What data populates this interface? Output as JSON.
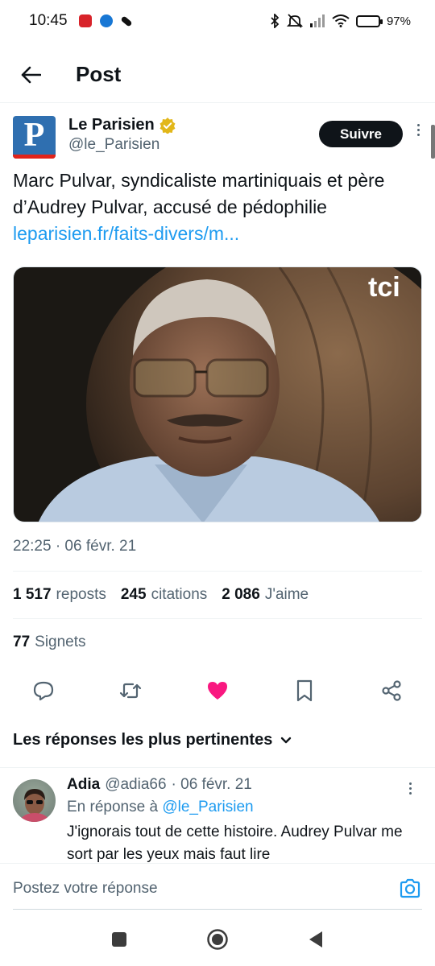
{
  "status_bar": {
    "time": "10:45",
    "battery": "97%",
    "battery_level": 0.97
  },
  "header": {
    "title": "Post",
    "back_icon": "arrow-left-icon"
  },
  "post": {
    "author": {
      "name": "Le Parisien",
      "handle": "@le_Parisien",
      "logo_letter": "P",
      "verified_color": "#e2b719"
    },
    "follow_label": "Suivre",
    "text": "Marc Pulvar, syndicaliste martiniquais et père d’Audrey Pulvar, accusé de pédophilie",
    "link": "leparisien.fr/faits-divers/m...",
    "image_watermark": "tci",
    "timestamp": "22:25 · 06 févr. 21",
    "stats": {
      "reposts_count": "1 517",
      "reposts_label": "reposts",
      "quotes_count": "245",
      "quotes_label": "citations",
      "likes_count": "2 086",
      "likes_label": "J'aime"
    },
    "bookmarks_count": "77",
    "bookmarks_label": "Signets",
    "actions": [
      "reply-icon",
      "repost-icon",
      "heart-icon",
      "bookmark-icon",
      "share-icon"
    ],
    "like_color": "#f91880"
  },
  "replies": {
    "sort_label": "Les réponses les plus pertinentes",
    "items": [
      {
        "name": "Adia",
        "handle": "@adia66",
        "date": "· 06 févr. 21",
        "in_reply_prefix": "En réponse à",
        "in_reply_mention": "@le_Parisien",
        "text": "J'ignorais tout de cette histoire. Audrey Pulvar me sort par les yeux mais faut lire"
      }
    ]
  },
  "compose": {
    "placeholder": "Postez votre réponse"
  },
  "colors": {
    "accent": "#1d9bf0",
    "text": "#0f1419",
    "secondary": "#536471"
  }
}
